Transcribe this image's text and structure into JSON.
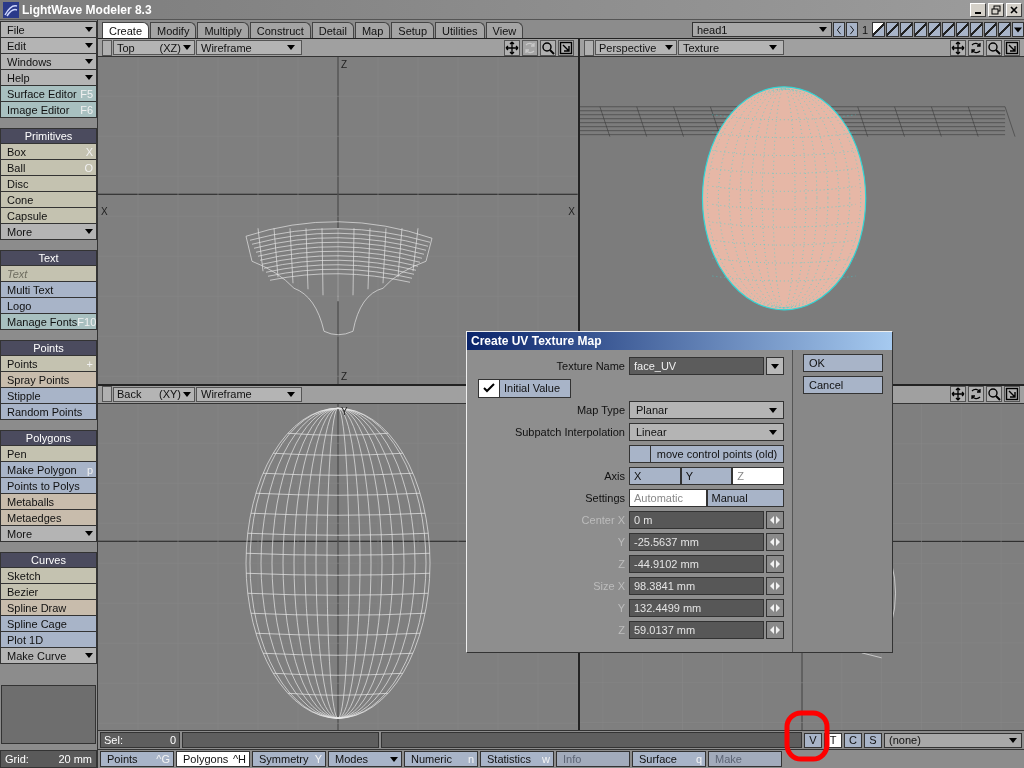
{
  "window": {
    "title": "LightWave Modeler 8.3"
  },
  "sidebar": {
    "groups": [
      {
        "items": [
          {
            "label": "File",
            "kind": "dropdown",
            "color": "#b4b4b4",
            "disabled": false
          },
          {
            "label": "Edit",
            "kind": "dropdown",
            "color": "#b4b4b4",
            "disabled": false
          },
          {
            "label": "Windows",
            "kind": "dropdown",
            "color": "#b4b4b4",
            "disabled": false
          },
          {
            "label": "Help",
            "kind": "dropdown",
            "color": "#b4b4b4",
            "disabled": false
          },
          {
            "label": "Surface Editor",
            "shortcut": "F5",
            "kind": "button",
            "color": "#a8c0c0",
            "disabled": false
          },
          {
            "label": "Image Editor",
            "shortcut": "F6",
            "kind": "button",
            "color": "#a8c0c0",
            "disabled": false
          }
        ]
      },
      {
        "header": "Primitives",
        "items": [
          {
            "label": "Box",
            "shortcut": "X",
            "kind": "button",
            "color": "#c4c2b0",
            "disabled": false
          },
          {
            "label": "Ball",
            "shortcut": "O",
            "kind": "button",
            "color": "#c4c2b0",
            "disabled": false
          },
          {
            "label": "Disc",
            "kind": "button",
            "color": "#c4c2b0",
            "disabled": false
          },
          {
            "label": "Cone",
            "kind": "button",
            "color": "#c4c2b0",
            "disabled": false
          },
          {
            "label": "Capsule",
            "kind": "button",
            "color": "#c4c2b0",
            "disabled": false
          },
          {
            "label": "More",
            "kind": "dropdown",
            "color": "#b4b4b4",
            "disabled": false
          }
        ]
      },
      {
        "header": "Text",
        "items": [
          {
            "label": "Text",
            "kind": "button",
            "color": "#c4c2b0",
            "disabled": true
          },
          {
            "label": "Multi Text",
            "kind": "button",
            "color": "#a8b4c8",
            "disabled": false
          },
          {
            "label": "Logo",
            "kind": "button",
            "color": "#a8b4c8",
            "disabled": false
          },
          {
            "label": "Manage Fonts",
            "shortcut": "F10",
            "kind": "button",
            "color": "#a8c0c0",
            "disabled": false
          }
        ]
      },
      {
        "header": "Points",
        "items": [
          {
            "label": "Points",
            "shortcut": "+",
            "kind": "button",
            "color": "#c4c2b0",
            "disabled": false
          },
          {
            "label": "Spray Points",
            "kind": "button",
            "color": "#c8bcac",
            "disabled": false
          },
          {
            "label": "Stipple",
            "kind": "button",
            "color": "#a8b4c8",
            "disabled": false
          },
          {
            "label": "Random Points",
            "kind": "button",
            "color": "#a8b4c8",
            "disabled": false
          }
        ]
      },
      {
        "header": "Polygons",
        "items": [
          {
            "label": "Pen",
            "kind": "button",
            "color": "#c4c2b0",
            "disabled": false
          },
          {
            "label": "Make Polygon",
            "shortcut": "p",
            "kind": "button",
            "color": "#a8b4c8",
            "disabled": false
          },
          {
            "label": "Points to Polys",
            "kind": "button",
            "color": "#a8b4c8",
            "disabled": false
          },
          {
            "label": "Metaballs",
            "kind": "button",
            "color": "#c8bcac",
            "disabled": false
          },
          {
            "label": "Metaedges",
            "kind": "button",
            "color": "#c8bcac",
            "disabled": false
          },
          {
            "label": "More",
            "kind": "dropdown",
            "color": "#b4b4b4",
            "disabled": false
          }
        ]
      },
      {
        "header": "Curves",
        "items": [
          {
            "label": "Sketch",
            "kind": "button",
            "color": "#c4c2b0",
            "disabled": false
          },
          {
            "label": "Bezier",
            "kind": "button",
            "color": "#c4c2b0",
            "disabled": false
          },
          {
            "label": "Spline Draw",
            "kind": "button",
            "color": "#c8bcac",
            "disabled": false
          },
          {
            "label": "Spline Cage",
            "kind": "button",
            "color": "#a8b4c8",
            "disabled": false
          },
          {
            "label": "Plot 1D",
            "kind": "button",
            "color": "#a8b4c8",
            "disabled": false
          },
          {
            "label": "Make Curve",
            "kind": "dropdown",
            "color": "#b4b4b4",
            "disabled": false
          }
        ]
      }
    ],
    "grid": {
      "label": "Grid:",
      "value": "20 mm"
    }
  },
  "tabs": [
    {
      "label": "Create",
      "selected": true
    },
    {
      "label": "Modify",
      "selected": false
    },
    {
      "label": "Multiply",
      "selected": false
    },
    {
      "label": "Construct",
      "selected": false
    },
    {
      "label": "Detail",
      "selected": false
    },
    {
      "label": "Map",
      "selected": false
    },
    {
      "label": "Setup",
      "selected": false
    },
    {
      "label": "Utilities",
      "selected": false
    },
    {
      "label": "View",
      "selected": false
    }
  ],
  "object_selector": {
    "value": "head1",
    "layer": "1"
  },
  "viewports": [
    {
      "kind": "top",
      "view": "Top",
      "axes": "(XZ)",
      "mode": "Wireframe",
      "rotate_disabled": true,
      "axis_labels": {
        "top": "Z",
        "left": "X",
        "right": "X",
        "bottom": "Z"
      }
    },
    {
      "kind": "perspective",
      "view": "Perspective",
      "mode": "Texture",
      "rotate_disabled": false
    },
    {
      "kind": "back",
      "view": "Back",
      "axes": "(XY)",
      "mode": "Wireframe",
      "axis_labels": {
        "top": "Y"
      }
    },
    {
      "kind": "partial",
      "rotate_disabled": false
    }
  ],
  "status_bar": {
    "sel_label": "Sel:",
    "sel_value": "0",
    "buttons": [
      {
        "label": "V",
        "selected": false
      },
      {
        "label": "T",
        "selected": true
      },
      {
        "label": "C",
        "selected": false
      },
      {
        "label": "S",
        "selected": false
      }
    ],
    "surface": "(none)"
  },
  "toolbar": [
    {
      "label": "Points",
      "shortcut": "^G",
      "kind": "button",
      "selected": false,
      "disabled": false
    },
    {
      "label": "Polygons",
      "shortcut": "^H",
      "kind": "button",
      "selected": true,
      "disabled": false
    },
    {
      "label": "Symmetry",
      "shortcut": "Y",
      "kind": "button",
      "selected": false,
      "disabled": false
    },
    {
      "label": "Modes",
      "kind": "dropdown",
      "selected": false,
      "disabled": false
    },
    {
      "label": "Numeric",
      "shortcut": "n",
      "kind": "button",
      "selected": false,
      "disabled": false
    },
    {
      "label": "Statistics",
      "shortcut": "w",
      "kind": "button",
      "selected": false,
      "disabled": false
    },
    {
      "label": "Info",
      "kind": "button",
      "selected": false,
      "disabled": true
    },
    {
      "label": "Surface",
      "shortcut": "q",
      "kind": "button",
      "selected": false,
      "disabled": false
    },
    {
      "label": "Make",
      "kind": "button",
      "selected": false,
      "disabled": true
    }
  ],
  "dialog": {
    "title": "Create UV Texture Map",
    "fields": [
      {
        "kind": "combo",
        "label": "Texture Name",
        "value": "face_UV"
      },
      {
        "kind": "checkbox",
        "label": "Initial Value",
        "checked": true
      },
      {
        "kind": "dropdown",
        "label": "Map Type",
        "value": "Planar"
      },
      {
        "kind": "dropdown",
        "label": "Subpatch Interpolation",
        "value": "Linear"
      },
      {
        "kind": "checkbox-wide",
        "label": "move control points (old)",
        "checked": false
      },
      {
        "kind": "segmented",
        "label": "Axis",
        "options": [
          {
            "label": "X",
            "selected": false
          },
          {
            "label": "Y",
            "selected": false
          },
          {
            "label": "Z",
            "selected": true
          }
        ]
      },
      {
        "kind": "segmented",
        "label": "Settings",
        "options": [
          {
            "label": "Automatic",
            "selected": true
          },
          {
            "label": "Manual",
            "selected": false
          }
        ]
      },
      {
        "kind": "number",
        "label": "Center X",
        "value": "0 m",
        "disabled": true
      },
      {
        "kind": "number",
        "label": "Y",
        "value": "-25.5637 mm",
        "disabled": true
      },
      {
        "kind": "number",
        "label": "Z",
        "value": "-44.9102 mm",
        "disabled": true
      },
      {
        "kind": "number",
        "label": "Size X",
        "value": "98.3841 mm",
        "disabled": true
      },
      {
        "kind": "number",
        "label": "Y",
        "value": "132.4499 mm",
        "disabled": true
      },
      {
        "kind": "number",
        "label": "Z",
        "value": "59.0137 mm",
        "disabled": true
      }
    ],
    "buttons": [
      "OK",
      "Cancel"
    ]
  }
}
